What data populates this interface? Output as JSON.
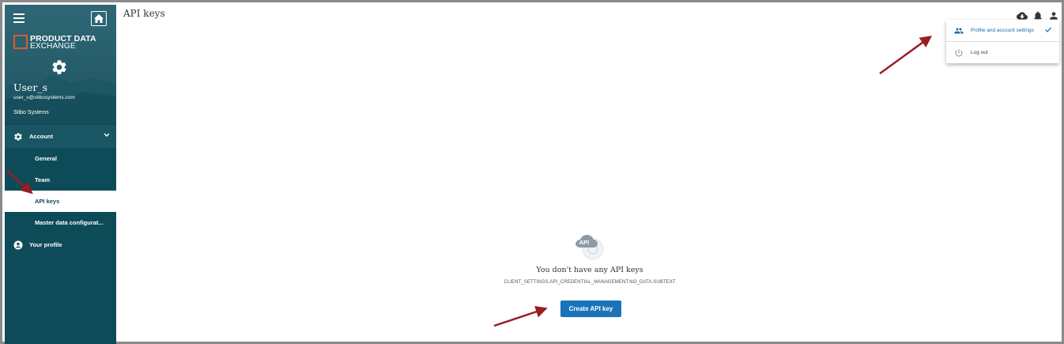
{
  "sidebar": {
    "logo": {
      "line1": "PRODUCT DATA",
      "line2": "EXCHANGE"
    },
    "user": {
      "name": "User_s",
      "email": "user_s@stibosystems.com",
      "org": "Stibo Systems"
    },
    "nav": {
      "account_label": "Account",
      "items": [
        {
          "label": "General"
        },
        {
          "label": "Team"
        },
        {
          "label": "API keys"
        },
        {
          "label": "Master data configurat..."
        }
      ],
      "profile_label": "Your profile"
    }
  },
  "header": {
    "title": "API keys"
  },
  "dropdown": {
    "items": [
      {
        "label": "Profile and account settings",
        "icon": "people-icon"
      },
      {
        "label": "Log out",
        "icon": "power-icon"
      }
    ]
  },
  "empty_state": {
    "title": "You don't have any API keys",
    "subtext": "CLIENT_SETTINGS.API_CREDENTIAL_MANAGEMENT.NO_DATA.SUBTEXT",
    "icon_label": "API",
    "create_button": "Create API key"
  },
  "colors": {
    "sidebar": "#0e4b58",
    "accent": "#1a73b8",
    "logo": "#e05a2b",
    "annotation": "#9b1c22"
  }
}
